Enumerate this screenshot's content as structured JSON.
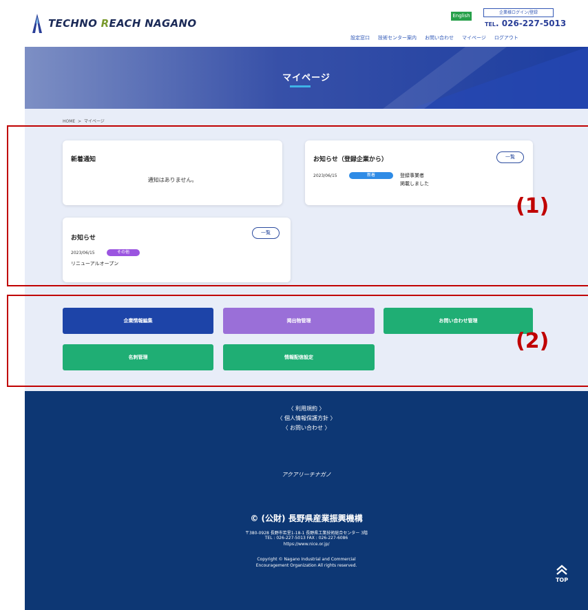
{
  "header": {
    "logo_text_1": "TECHNO ",
    "logo_text_r": "R",
    "logo_text_2": "EACH NAGANO",
    "lang_label": "English",
    "login_label": "企業様ログイン/登録",
    "tel_label": "TEL",
    "tel_number": "026-227-5013",
    "nav": [
      "設定窓口",
      "技術センター案内",
      "お問い合わせ",
      "マイページ",
      "ログアウト"
    ]
  },
  "hero": {
    "title": "マイページ"
  },
  "breadcrumb": {
    "home": "HOME",
    "sep": ">",
    "current": "マイページ"
  },
  "cards": {
    "notice_new": {
      "title": "新着通知",
      "empty": "通知はありません。"
    },
    "news_company": {
      "title": "お知らせ（登録企業から）",
      "more": "一覧",
      "date": "2023/06/15",
      "tag": "新着",
      "text_1": "登録事業者",
      "text_2": "掲載しました"
    },
    "news": {
      "title": "お知らせ",
      "more": "一覧",
      "date": "2023/06/15",
      "tag": "その他",
      "text": "リニューアルオープン"
    }
  },
  "annotations": {
    "label_1": "(1)",
    "label_2": "(2)"
  },
  "actions": [
    {
      "label": "企業情報編集",
      "color": "#1d44a8"
    },
    {
      "label": "掲出物管理",
      "color": "#9a6fd8"
    },
    {
      "label": "お問い合わせ管理",
      "color": "#1fae74"
    },
    {
      "label": "名刺管理",
      "color": "#1fae74"
    },
    {
      "label": "情報配信設定",
      "color": "#1fae74"
    }
  ],
  "footer": {
    "links": [
      "〈 利用規約 〉",
      "〈 個人情報保護方針 〉",
      "〈 お問い合わせ 〉"
    ],
    "sub_logo": "アクアリーチナガノ",
    "org_name": "© (公財) 長野県産業振興機構",
    "address": "〒380-0928 長野市若里1-18-1 長野県工業技術総合センター 3階",
    "contact": "TEL : 026-227-5013  FAX : 026-227-6086",
    "url": "https://www.nice.or.jp/",
    "copyright_1": "Copyright © Nagano Industrial and Commercial",
    "copyright_2": "Encouragement Organization All rights reserved.",
    "top_label": "TOP"
  },
  "colors": {
    "brand_blue": "#1d44a8",
    "footer_navy": "#0d3774",
    "annotation_red": "#c00000",
    "main_bg": "#e8edf8"
  }
}
